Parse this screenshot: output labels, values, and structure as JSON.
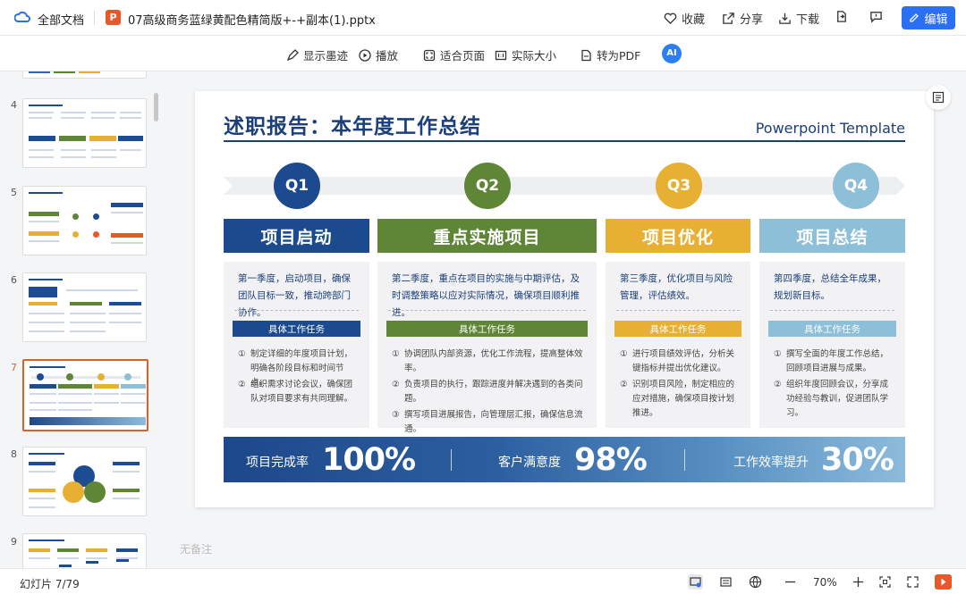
{
  "topbar": {
    "all_docs": "全部文档",
    "file_badge": "P",
    "file_name": "07高级商务蓝绿黄配色精简版+-+副本(1).pptx",
    "favorite": "收藏",
    "share": "分享",
    "download": "下载",
    "edit": "编辑"
  },
  "toolbar": {
    "show_ink": "显示墨迹",
    "play": "播放",
    "fit_page": "适合页面",
    "actual_size": "实际大小",
    "to_pdf": "转为PDF",
    "ai": "AI"
  },
  "sidebar": {
    "slide_numbers": [
      "4",
      "5",
      "6",
      "7",
      "8",
      "9"
    ],
    "selected": "7"
  },
  "slide": {
    "title": "述职报告：本年度工作总结",
    "subtitle": "Powerpoint Template",
    "task_label": "具体工作任务",
    "quarters": [
      {
        "q": "Q1",
        "title": "项目启动",
        "color": "#1b4a8e",
        "desc": "第一季度，启动项目，确保团队目标一致，推动跨部门协作。",
        "tasks": [
          "制定详细的年度项目计划，明确各阶段目标和时间节点。",
          "组织需求讨论会议，确保团队对项目要求有共同理解。"
        ]
      },
      {
        "q": "Q2",
        "title": "重点实施项目",
        "color": "#5e8636",
        "desc": "第二季度，重点在项目的实施与中期评估，及时调整策略以应对实际情况，确保项目顺利推进。",
        "tasks": [
          "协调团队内部资源，优化工作流程，提高整体效率。",
          "负责项目的执行，跟踪进度并解决遇到的各类问题。",
          "撰写项目进展报告，向管理层汇报，确保信息流通。"
        ]
      },
      {
        "q": "Q3",
        "title": "项目优化",
        "color": "#e8b033",
        "desc": "第三季度，优化项目与风险管理，评估绩效。",
        "tasks": [
          "进行项目绩效评估，分析关键指标并提出优化建议。",
          "识别项目风险，制定相应的应对措施，确保项目按计划推进。"
        ]
      },
      {
        "q": "Q4",
        "title": "项目总结",
        "color": "#8dbfd8",
        "desc": "第四季度，总结全年成果，规划新目标。",
        "tasks": [
          "撰写全面的年度工作总结，回顾项目进展与成果。",
          "组织年度回顾会议，分享成功经验与教训，促进团队学习。"
        ]
      }
    ],
    "stats": [
      {
        "label": "项目完成率",
        "value": "100%"
      },
      {
        "label": "客户满意度",
        "value": "98%"
      },
      {
        "label": "工作效率提升",
        "value": "30%"
      }
    ]
  },
  "notes": "无备注",
  "status": {
    "slide_count": "幻灯片 7/79",
    "zoom": "70%"
  }
}
